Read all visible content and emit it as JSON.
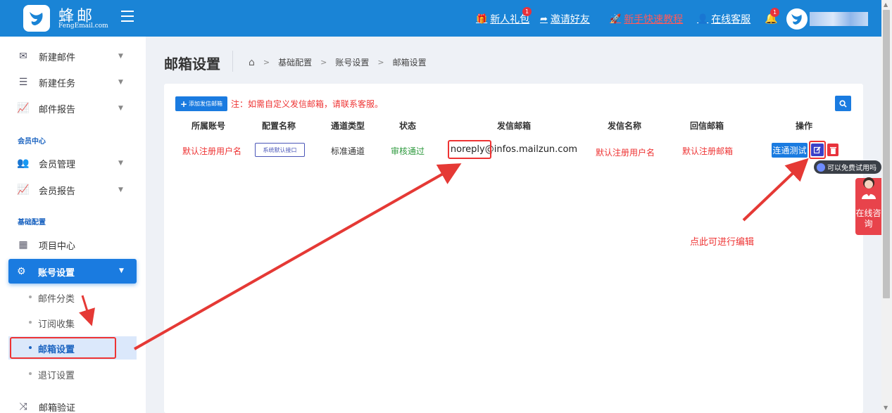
{
  "header": {
    "logo_title": "蜂邮",
    "logo_sub": "FengEmail.com",
    "links": {
      "gift": "新人礼包",
      "gift_badge": "1",
      "invite": "邀请好友",
      "tutorial": "新手快速教程",
      "support": "在线客服"
    },
    "bell_badge": "1"
  },
  "sidebar": {
    "items": [
      {
        "label": "新建邮件"
      },
      {
        "label": "新建任务"
      },
      {
        "label": "邮件报告"
      }
    ],
    "section_member": "会员中心",
    "member_items": [
      {
        "label": "会员管理"
      },
      {
        "label": "会员报告"
      }
    ],
    "section_basic": "基础配置",
    "project_center": "项目中心",
    "account_settings": "账号设置",
    "sub_items": [
      {
        "label": "邮件分类"
      },
      {
        "label": "订阅收集"
      },
      {
        "label": "邮箱设置"
      },
      {
        "label": "退订设置"
      }
    ],
    "email_verify": "邮箱验证"
  },
  "page": {
    "title": "邮箱设置",
    "breadcrumb": [
      "基础配置",
      "账号设置",
      "邮箱设置"
    ]
  },
  "card": {
    "add_button": "添加发信邮箱",
    "note": "注：如需自定义发信邮箱，请联系客服。",
    "columns": [
      "所属账号",
      "配置名称",
      "通道类型",
      "状态",
      "发信邮箱",
      "发信名称",
      "回信邮箱",
      "操作"
    ],
    "row": {
      "account": "默认注册用户名",
      "config_name": "系统默认接口",
      "channel": "标准通道",
      "status": "审核通过",
      "sender_email": "noreply@infos.mailzun.com",
      "sender_name": "默认注册用户名",
      "reply_email": "默认注册邮箱",
      "test_button": "连通测试"
    }
  },
  "annotation": {
    "edit_hint": "点此可进行编辑"
  },
  "floating": {
    "tooltip": "可以免费试用吗",
    "consult": "在线咨询"
  },
  "colors": {
    "primary": "#1a84d6",
    "accent_red": "#e33333",
    "status_green": "#2f9a3f",
    "edit_purple": "#3b40c9"
  }
}
